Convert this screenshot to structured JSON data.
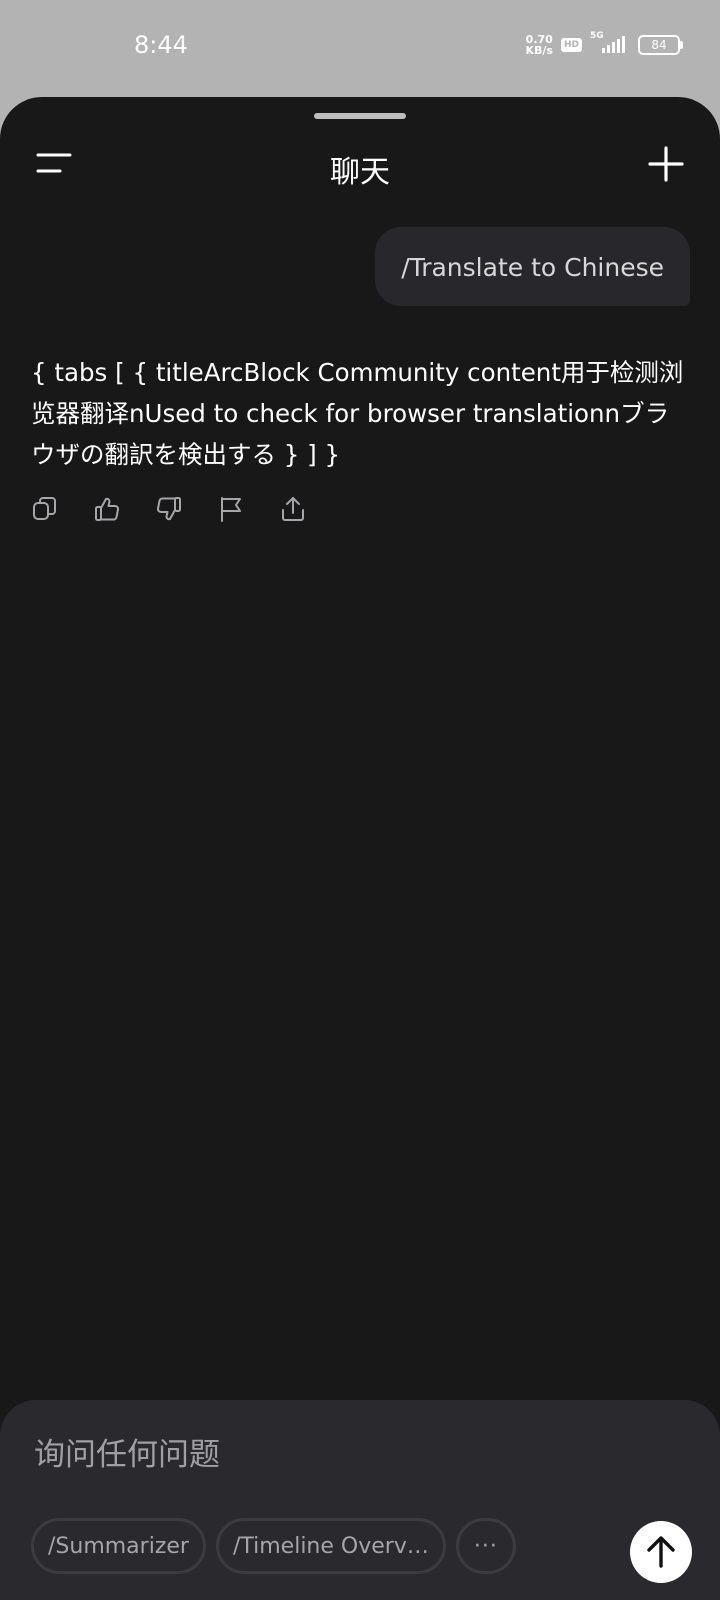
{
  "status_bar": {
    "time": "8:44",
    "net_speed_value": "0.70",
    "net_speed_unit": "KB/s",
    "hd_label": "HD",
    "network_label": "5G",
    "battery": "84"
  },
  "header": {
    "title": "聊天"
  },
  "messages": {
    "user": "/Translate to Chinese",
    "assistant": "{ tabs [ { titleArcBlock Community     content用于检测浏览器翻译nUsed to check for browser translationnブラウザの翻訳を検出する    } ] }"
  },
  "composer": {
    "placeholder": "询问任何问题",
    "chips": [
      "/Summarizer",
      "/Timeline Overv…",
      "···"
    ]
  },
  "icons": {
    "menu": "menu-icon",
    "new_chat": "plus-icon",
    "copy": "copy-icon",
    "like": "thumbs-up-icon",
    "dislike": "thumbs-down-icon",
    "report": "flag-icon",
    "share": "share-icon",
    "send": "arrow-up-icon"
  },
  "colors": {
    "background": "#181819",
    "bubble": "#28282c",
    "composer": "#2a2a2e"
  }
}
